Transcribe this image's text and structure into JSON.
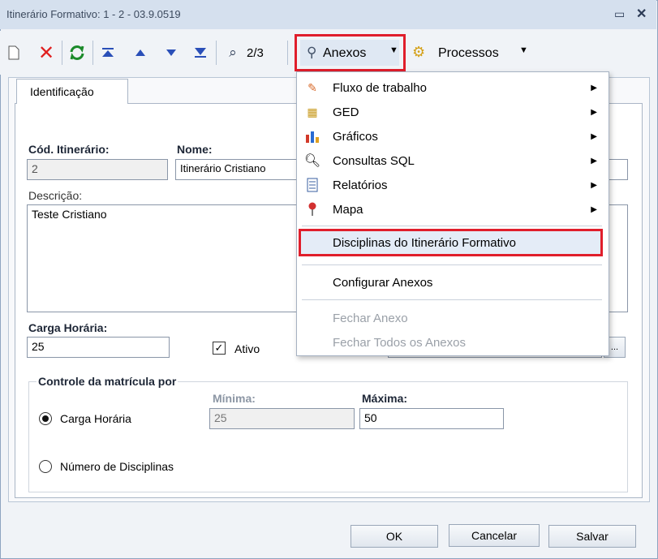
{
  "window": {
    "title": "Itinerário Formativo: 1 - 2 - 03.9.0519"
  },
  "toolbar": {
    "record_position": "2/3",
    "anexos_label": "Anexos",
    "processos_label": "Processos"
  },
  "tabs": {
    "identificacao": "Identificação"
  },
  "form": {
    "cod_label": "Cód. Itinerário:",
    "cod_value": "2",
    "nome_label": "Nome:",
    "nome_value": "Itinerário Cristiano",
    "descricao_label": "Descrição:",
    "descricao_value": "Teste Cristiano",
    "carga_label": "Carga Horária:",
    "carga_value": "25",
    "ativo_label": "Ativo",
    "browse_label": "..."
  },
  "controle": {
    "legend": "Controle da matrícula por",
    "minima_label": "Mínima:",
    "maxima_label": "Máxima:",
    "minima_value": "25",
    "maxima_value": "50",
    "option_carga": "Carga Horária",
    "option_disciplinas": "Número de Disciplinas",
    "selected": "Carga Horária"
  },
  "menu": {
    "items": [
      {
        "label": "Fluxo de trabalho"
      },
      {
        "label": "GED"
      },
      {
        "label": "Gráficos"
      },
      {
        "label": "Consultas SQL"
      },
      {
        "label": "Relatórios"
      },
      {
        "label": "Mapa"
      }
    ],
    "disciplinas": "Disciplinas do Itinerário Formativo",
    "configurar": "Configurar Anexos",
    "fechar_anexo": "Fechar Anexo",
    "fechar_todos": "Fechar Todos os Anexos"
  },
  "buttons": {
    "ok": "OK",
    "cancelar": "Cancelar",
    "salvar": "Salvar"
  },
  "colors": {
    "highlight": "#e01e2b",
    "titlebar": "#d5e0ee"
  }
}
